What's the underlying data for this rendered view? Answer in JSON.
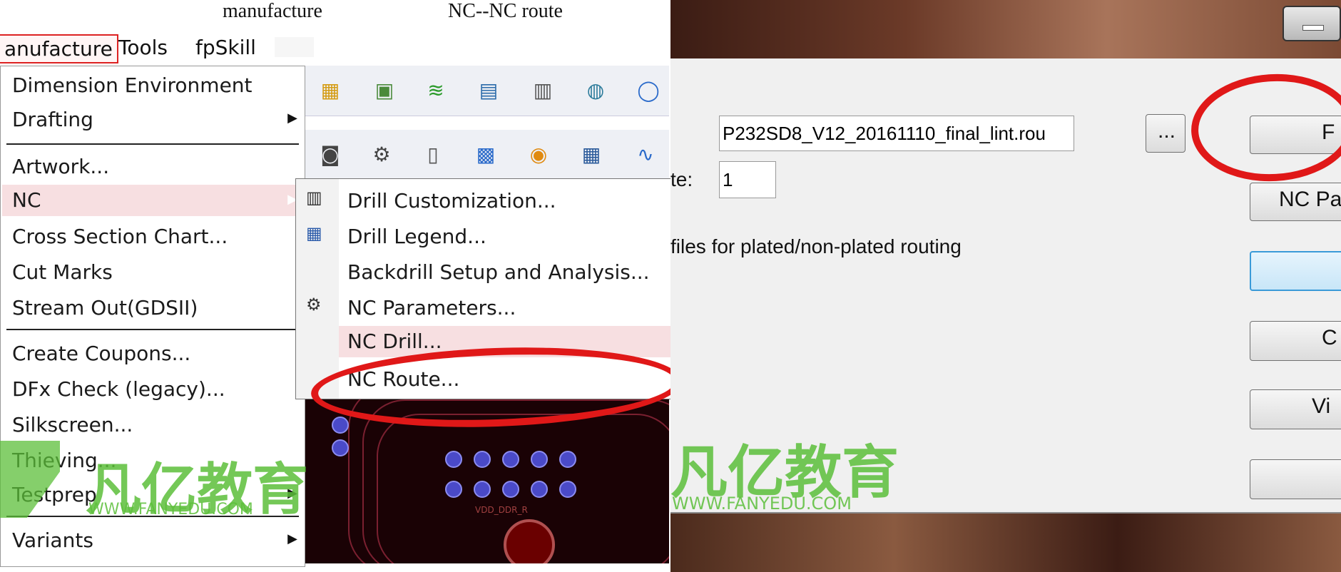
{
  "captions": {
    "left": "manufacture",
    "right": "NC--NC  route"
  },
  "menubar": {
    "items": [
      {
        "label": "anufacture",
        "active": true
      },
      {
        "label": "Tools"
      },
      {
        "label": "fpSkill"
      }
    ]
  },
  "menu": {
    "items": [
      "Dimension Environment",
      "Drafting",
      "Artwork...",
      "NC",
      "Cross Section Chart...",
      "Cut Marks",
      "Stream Out(GDSII)",
      "Create Coupons...",
      "DFx Check (legacy)...",
      "Silkscreen...",
      "Thieving...",
      "Testprep",
      "Variants"
    ]
  },
  "submenu": {
    "items": [
      "Drill Customization...",
      "Drill Legend...",
      "Backdrill Setup and Analysis...",
      "NC Parameters...",
      "NC Drill...",
      "NC Route..."
    ]
  },
  "pcb": {
    "net_label": "VDD_DDR_R"
  },
  "dialog": {
    "file_value": "P232SD8_V12_20161110_final_lint.rou",
    "browse_label": "...",
    "te_label": "te:",
    "te_value": "1",
    "checkbox_text": "files for plated/non-plated routing",
    "buttons": [
      "F",
      "NC Pa",
      "",
      "C",
      "Vi",
      ""
    ]
  },
  "watermark": {
    "cn": "凡亿教育",
    "url": "WWW.FANYEDU.COM"
  },
  "colors": {
    "highlight": "#f7dfe1",
    "annotation_red": "#e01818",
    "watermark_green": "#5cbf3a"
  }
}
